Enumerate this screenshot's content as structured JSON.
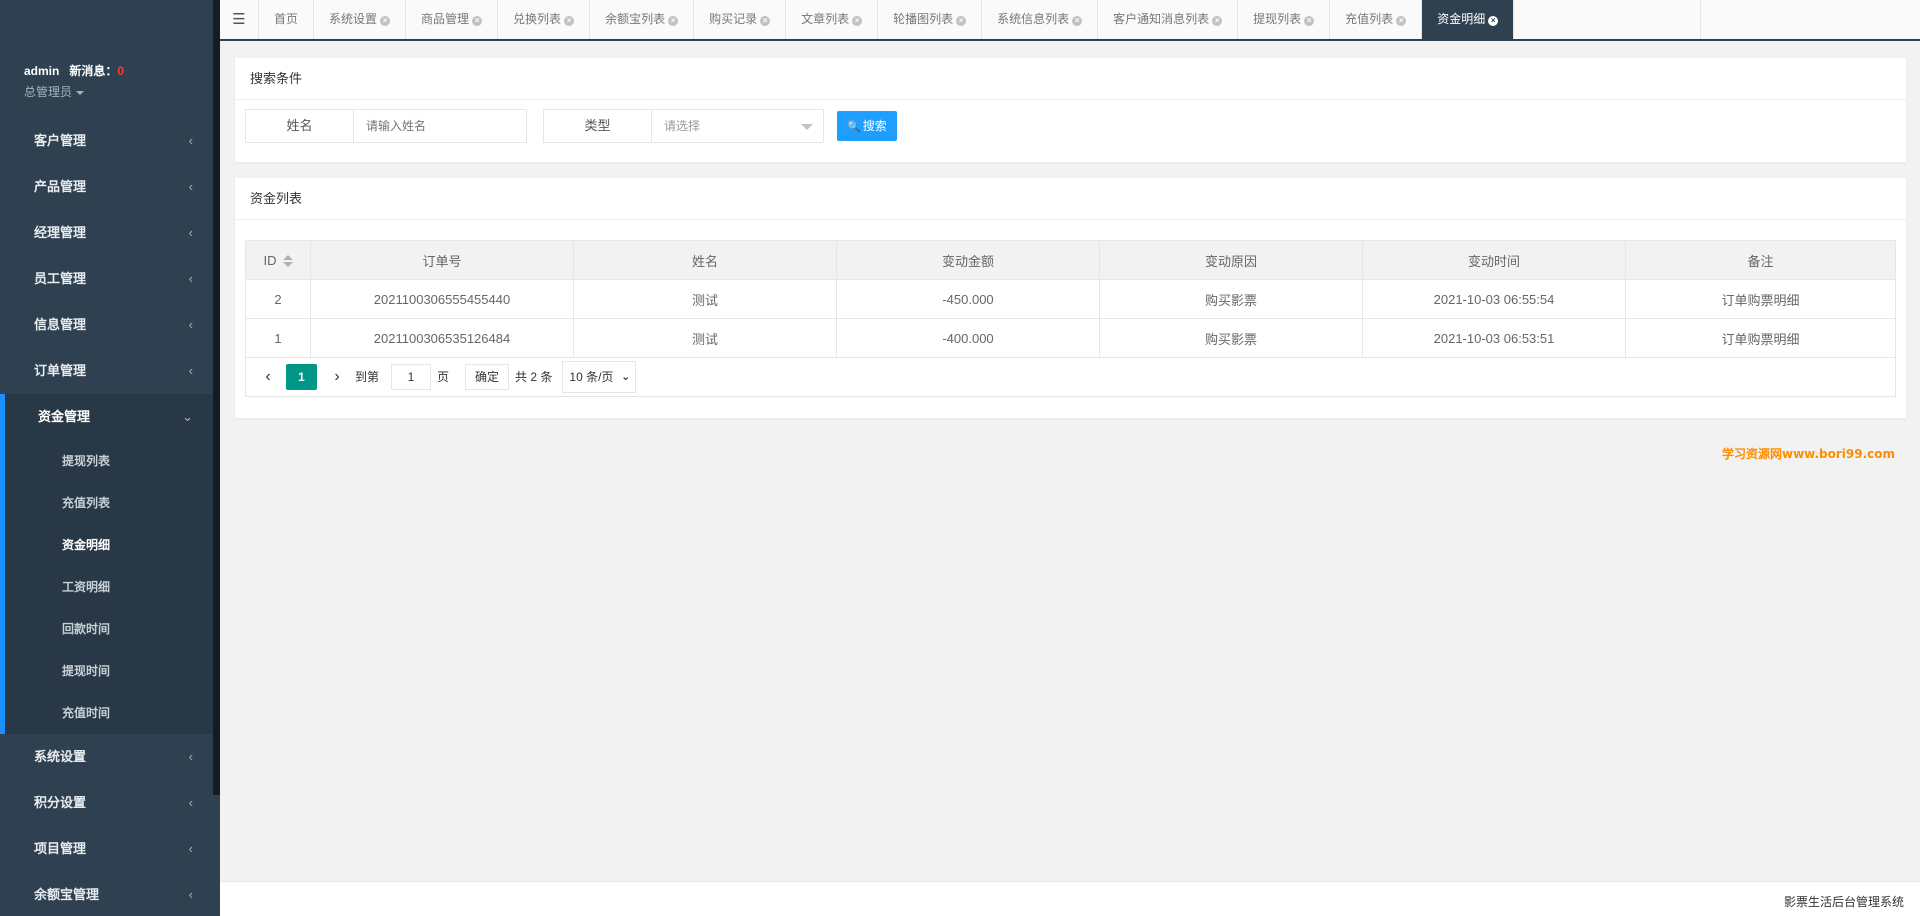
{
  "user": {
    "name": "admin",
    "message_label": "新消息：",
    "message_count": "0",
    "role": "总管理员"
  },
  "sidebar": {
    "items_top": [
      {
        "label": "客户管理"
      },
      {
        "label": "产品管理"
      },
      {
        "label": "经理管理"
      },
      {
        "label": "员工管理"
      },
      {
        "label": "信息管理"
      },
      {
        "label": "订单管理"
      }
    ],
    "open_group": {
      "label": "资金管理",
      "children": [
        {
          "label": "提现列表"
        },
        {
          "label": "充值列表"
        },
        {
          "label": "资金明细"
        },
        {
          "label": "工资明细"
        },
        {
          "label": "回款时间"
        },
        {
          "label": "提现时间"
        },
        {
          "label": "充值时间"
        }
      ]
    },
    "items_bottom": [
      {
        "label": "系统设置"
      },
      {
        "label": "积分设置"
      },
      {
        "label": "项目管理"
      },
      {
        "label": "余额宝管理"
      }
    ],
    "arrow_glyph": "‹",
    "open_arrow_glyph": "⌄"
  },
  "tabs": [
    {
      "label": "首页"
    },
    {
      "label": "系统设置"
    },
    {
      "label": "商品管理"
    },
    {
      "label": "兑换列表"
    },
    {
      "label": "余额宝列表"
    },
    {
      "label": "购买记录"
    },
    {
      "label": "文章列表"
    },
    {
      "label": "轮播图列表"
    },
    {
      "label": "系统信息列表"
    },
    {
      "label": "客户通知消息列表"
    },
    {
      "label": "提现列表"
    },
    {
      "label": "充值列表"
    },
    {
      "label": "资金明细"
    }
  ],
  "search": {
    "title": "搜索条件",
    "name_label": "姓名",
    "name_placeholder": "请输入姓名",
    "type_label": "类型",
    "type_placeholder": "请选择",
    "button_label": "搜索"
  },
  "list": {
    "title": "资金列表",
    "columns": [
      "ID",
      "订单号",
      "姓名",
      "变动金额",
      "变动原因",
      "变动时间",
      "备注"
    ],
    "rows": [
      [
        "2",
        "2021100306555455440",
        "测试",
        "-450.000",
        "购买影票",
        "2021-10-03 06:55:54",
        "订单购票明细"
      ],
      [
        "1",
        "2021100306535126484",
        "测试",
        "-400.000",
        "购买影票",
        "2021-10-03 06:53:51",
        "订单购票明细"
      ]
    ]
  },
  "pager": {
    "current_page": "1",
    "goto_label": "到第",
    "page_input": "1",
    "page_unit": "页",
    "confirm_label": "确定",
    "total_label": "共 2 条",
    "page_size": "10 条/页"
  },
  "watermark": "学习资源网www.bori99.com",
  "footer": "影票生活后台管理系统",
  "colors": {
    "sidebar_bg": "#2f4050",
    "accent_blue": "#1e9fff",
    "pager_active": "#009688",
    "message_count": "#ff3838",
    "watermark": "#ff8c00"
  }
}
